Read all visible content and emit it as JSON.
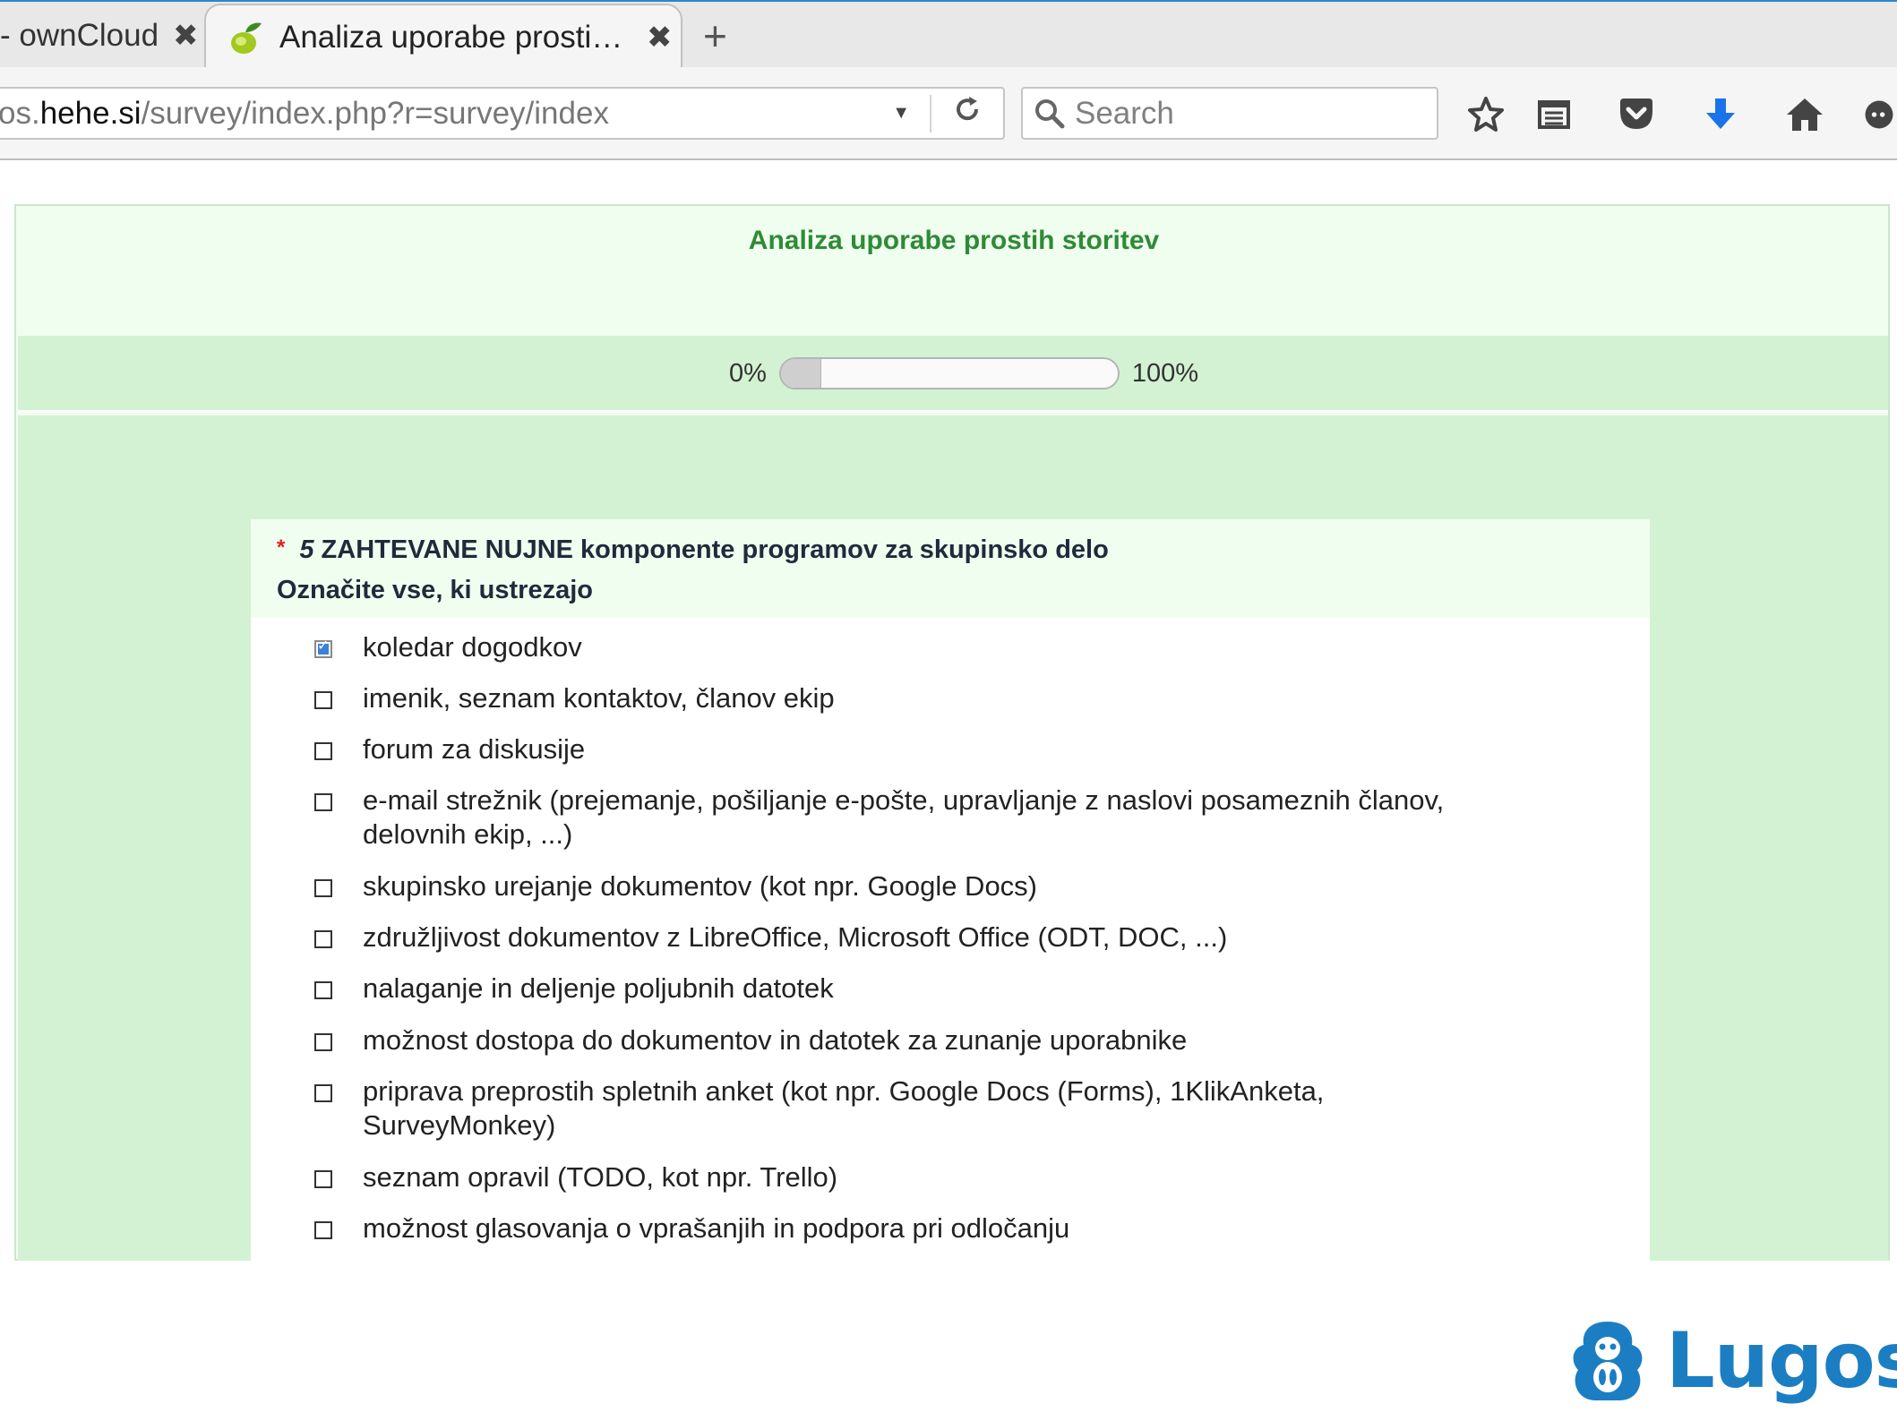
{
  "browser": {
    "tabs": [
      {
        "title": "- ownCloud",
        "active": false
      },
      {
        "title": "Analiza uporabe prosti…",
        "active": true
      }
    ],
    "url": {
      "prefix": "os.",
      "host": "hehe.si",
      "path": "/survey/index.php?r=survey/index"
    },
    "search": {
      "placeholder": "Search"
    },
    "tab_close_glyph": "✖",
    "new_tab_glyph": "+"
  },
  "survey": {
    "title": "Analiza uporabe prostih storitev",
    "progress": {
      "min_label": "0%",
      "max_label": "100%",
      "value_percent": 12
    },
    "question": {
      "required_mark": "*",
      "number": "5",
      "text": "ZAHTEVANE NUJNE komponente programov za skupinsko delo",
      "help": "Označite vse, ki ustrezajo",
      "options": [
        {
          "label": "koledar dogodkov",
          "checked": true
        },
        {
          "label": "imenik, seznam kontaktov, članov ekip",
          "checked": false
        },
        {
          "label": "forum za diskusije",
          "checked": false
        },
        {
          "label": "e-mail strežnik (prejemanje, pošiljanje e-pošte, upravljanje z naslovi posameznih članov, delovnih ekip, ...)",
          "checked": false
        },
        {
          "label": "skupinsko urejanje dokumentov (kot npr. Google Docs)",
          "checked": false
        },
        {
          "label": "združljivost dokumentov z LibreOffice, Microsoft Office (ODT, DOC, ...)",
          "checked": false
        },
        {
          "label": "nalaganje in deljenje poljubnih datotek",
          "checked": false
        },
        {
          "label": "možnost dostopa do dokumentov in datotek za zunanje uporabnike",
          "checked": false
        },
        {
          "label": "priprava preprostih spletnih anket (kot npr. Google Docs (Forms), 1KlikAnketa, SurveyMonkey)",
          "checked": false
        },
        {
          "label": "seznam opravil (TODO, kot npr. Trello)",
          "checked": false
        },
        {
          "label": "možnost glasovanja o vprašanjih in podpora pri odločanju",
          "checked": false
        }
      ]
    }
  },
  "logo": {
    "text": "Lugos"
  },
  "colors": {
    "accent_blue": "#1c7ec2",
    "title_green": "#2e8b35",
    "band_green": "#d3f2d3",
    "pale_green": "#f0fef0"
  }
}
